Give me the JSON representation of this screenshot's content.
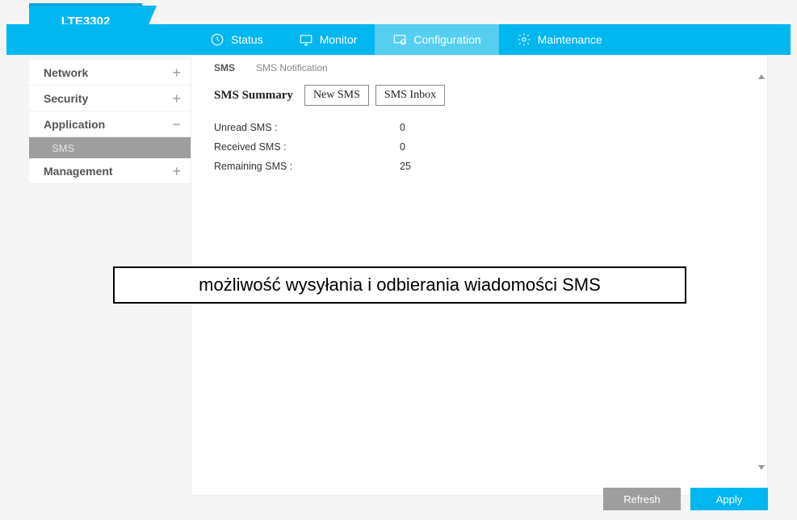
{
  "product_name": "LTE3302",
  "nav": {
    "status": "Status",
    "monitor": "Monitor",
    "configuration": "Configuration",
    "maintenance": "Maintenance"
  },
  "sidebar": {
    "network": "Network",
    "security": "Security",
    "application": "Application",
    "sms": "SMS",
    "management": "Management",
    "plus": "+",
    "minus": "−"
  },
  "tabs": {
    "sms": "SMS",
    "sms_notification": "SMS Notification"
  },
  "section": {
    "heading": "SMS Summary",
    "new_sms": "New SMS",
    "sms_inbox": "SMS Inbox"
  },
  "stats": {
    "unread_label": "Unread SMS :",
    "unread_value": "0",
    "received_label": "Received SMS :",
    "received_value": "0",
    "remaining_label": "Remaining SMS :",
    "remaining_value": "25"
  },
  "annotation": "możliwość wysyłania i odbierania wiadomości SMS",
  "buttons": {
    "refresh": "Refresh",
    "apply": "Apply"
  }
}
